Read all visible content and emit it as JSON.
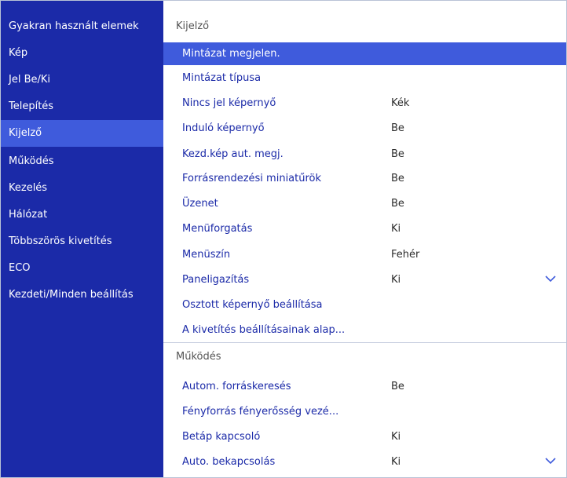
{
  "sidebar": {
    "items": [
      {
        "label": "Gyakran használt elemek",
        "selected": false
      },
      {
        "label": "Kép",
        "selected": false
      },
      {
        "label": "Jel Be/Ki",
        "selected": false
      },
      {
        "label": "Telepítés",
        "selected": false
      },
      {
        "label": "Kijelző",
        "selected": true
      },
      {
        "label": "Működés",
        "selected": false
      },
      {
        "label": "Kezelés",
        "selected": false
      },
      {
        "label": "Hálózat",
        "selected": false
      },
      {
        "label": "Többszörös kivetítés",
        "selected": false
      },
      {
        "label": "ECO",
        "selected": false
      },
      {
        "label": "Kezdeti/Minden beállítás",
        "selected": false
      }
    ]
  },
  "sections": [
    {
      "header": "Kijelző",
      "rows": [
        {
          "label": "Mintázat megjelen.",
          "value": "",
          "selected": true
        },
        {
          "label": "Mintázat típusa",
          "value": ""
        },
        {
          "label": "Nincs jel képernyő",
          "value": "Kék"
        },
        {
          "label": "Induló képernyő",
          "value": "Be"
        },
        {
          "label": "Kezd.kép aut. megj.",
          "value": "Be"
        },
        {
          "label": "Forrásrendezési miniatűrök",
          "value": "Be"
        },
        {
          "label": "Üzenet",
          "value": "Be"
        },
        {
          "label": "Menüforgatás",
          "value": "Ki"
        },
        {
          "label": "Menüszín",
          "value": "Fehér"
        },
        {
          "label": "Paneligazítás",
          "value": "Ki",
          "chevron": "chevron-down-icon"
        },
        {
          "label": "Osztott képernyő beállítása",
          "value": ""
        },
        {
          "label": "A kivetítés beállításainak alap...",
          "value": ""
        }
      ]
    },
    {
      "header": "Működés",
      "rows": [
        {
          "label": "Autom. forráskeresés",
          "value": "Be"
        },
        {
          "label": "Fényforrás fényerősség vezé...",
          "value": ""
        },
        {
          "label": "Betáp kapcsoló",
          "value": "Ki"
        },
        {
          "label": "Auto. bekapcsolás",
          "value": "Ki",
          "chevron": "chevron-down-icon"
        }
      ]
    }
  ],
  "colors": {
    "sidebar_bg": "#1b2aa8",
    "highlight": "#3f5bdc",
    "item_text": "#1b2aa8",
    "value_text": "#2b2b2b",
    "header_text": "#555555"
  }
}
